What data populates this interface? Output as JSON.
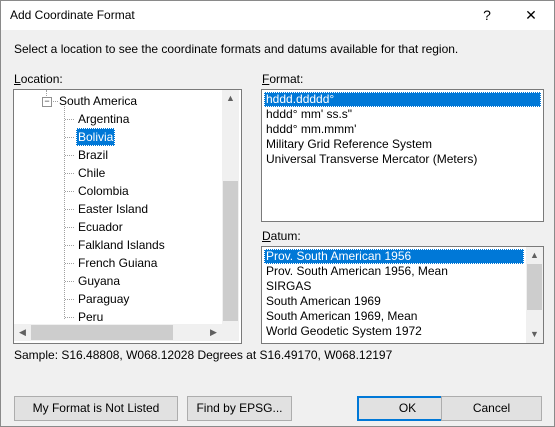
{
  "dialog": {
    "title": "Add Coordinate Format",
    "help_glyph": "?",
    "close_glyph": "✕",
    "intro": "Select a location to see the coordinate formats and datums available for that region."
  },
  "location": {
    "label_first": "L",
    "label_rest": "ocation:",
    "parent": "South America",
    "expander_glyph": "−",
    "children": [
      "Argentina",
      "Bolivia",
      "Brazil",
      "Chile",
      "Colombia",
      "Easter Island",
      "Ecuador",
      "Falkland Islands",
      "French Guiana",
      "Guyana",
      "Paraguay",
      "Peru"
    ],
    "selected": "Bolivia"
  },
  "format": {
    "label_first": "F",
    "label_rest": "ormat:",
    "items": [
      "hddd.ddddd°",
      "hddd° mm' ss.s\"",
      "hddd° mm.mmm'",
      "Military Grid Reference System",
      "Universal Transverse Mercator (Meters)"
    ],
    "selected": "hddd.ddddd°"
  },
  "datum": {
    "label_first": "D",
    "label_rest": "atum:",
    "items": [
      "Prov. South American 1956",
      "Prov. South American 1956, Mean",
      "SIRGAS",
      "South American 1969",
      "South American 1969, Mean",
      "World Geodetic System 1972"
    ],
    "selected": "Prov. South American 1956"
  },
  "sample": "Sample: S16.48808, W068.12028 Degrees at S16.49170, W068.12197",
  "buttons": {
    "not_listed": "My Format is Not Listed",
    "find_epsg": "Find by EPSG...",
    "ok": "OK",
    "cancel": "Cancel"
  },
  "scroll_glyphs": {
    "up": "▲",
    "down": "▼",
    "left": "◀",
    "right": "▶"
  }
}
